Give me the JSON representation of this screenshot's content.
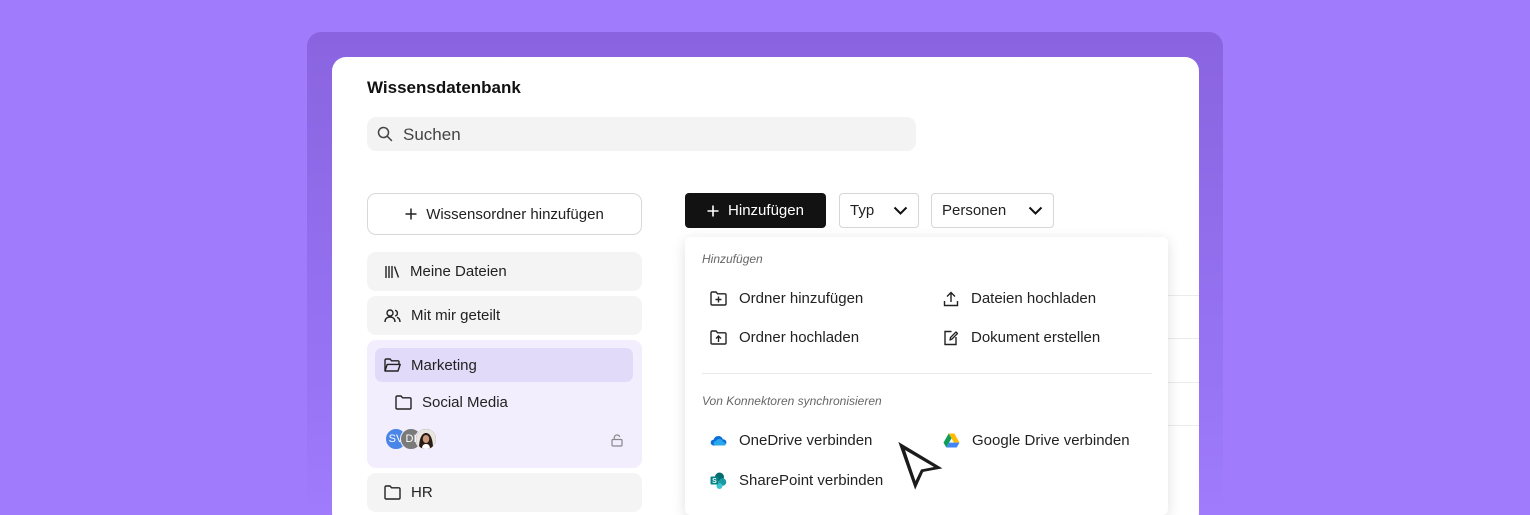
{
  "app": {
    "title": "Wissensdatenbank"
  },
  "search": {
    "placeholder": "Suchen"
  },
  "sidebar": {
    "add_folder_label": "Wissensordner hinzufügen",
    "items": [
      {
        "label": "Meine Dateien",
        "icon": "library-icon"
      },
      {
        "label": "Mit mir geteilt",
        "icon": "users-icon"
      }
    ],
    "group": {
      "folder_label": "Marketing",
      "subfolder_label": "Social Media",
      "avatars": [
        {
          "initials": "SV",
          "color": "#4a86e8"
        },
        {
          "initials": "DI",
          "color": "#7a7a7a"
        },
        {
          "initials": "",
          "color": "#3b2a26"
        }
      ]
    },
    "hr_label": "HR"
  },
  "toolbar": {
    "add_label": "Hinzufügen",
    "type_filter": "Typ",
    "people_filter": "Personen"
  },
  "add_menu": {
    "section_add": "Hinzufügen",
    "add_folder": "Ordner hinzufügen",
    "upload_files": "Dateien hochladen",
    "upload_folder": "Ordner hochladen",
    "create_document": "Dokument erstellen",
    "section_connectors": "Von Konnektoren synchronisieren",
    "onedrive": "OneDrive verbinden",
    "google_drive": "Google Drive verbinden",
    "sharepoint": "SharePoint verbinden"
  },
  "colors": {
    "background": "#a07cfc",
    "active_group": "#f2eefd",
    "active_item": "#e2daf9",
    "primary_button": "#121212"
  }
}
